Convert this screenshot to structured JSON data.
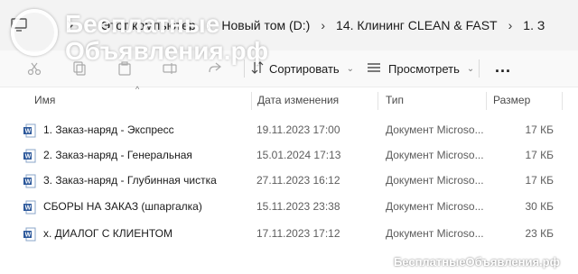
{
  "addressbar": {
    "breadcrumbs": [
      "Этот компьютер",
      "Новый том (D:)",
      "14. Клининг CLEAN & FAST",
      "1. З"
    ]
  },
  "toolbar": {
    "sort_label": "Сортировать",
    "view_label": "Просмотреть",
    "more_label": "..."
  },
  "columns": {
    "name": "Имя",
    "date": "Дата изменения",
    "type": "Тип",
    "size": "Размер"
  },
  "files": [
    {
      "name": "1.  Заказ-наряд - Экспресс",
      "date": "19.11.2023 17:00",
      "type": "Документ Microso...",
      "size": "17 КБ",
      "icon": "word-doc-icon"
    },
    {
      "name": "2.  Заказ-наряд - Генеральная",
      "date": "15.01.2024 17:13",
      "type": "Документ Microso...",
      "size": "17 КБ",
      "icon": "word-doc-icon"
    },
    {
      "name": "3.  Заказ-наряд - Глубинная чистка",
      "date": "27.11.2023 16:12",
      "type": "Документ Microso...",
      "size": "17 КБ",
      "icon": "word-doc-icon"
    },
    {
      "name": "СБОРЫ НА ЗАКАЗ (шпаргалка)",
      "date": "15.11.2023 23:38",
      "type": "Документ Microso...",
      "size": "30 КБ",
      "icon": "word-doc-icon"
    },
    {
      "name": "x. ДИАЛОГ С КЛИЕНТОМ",
      "date": "17.11.2023 17:12",
      "type": "Документ Microso...",
      "size": "23 КБ",
      "icon": "word-doc-icon"
    }
  ],
  "watermark": {
    "line1": "Бесплатные",
    "line2": "Объявления.рф",
    "footer": "БесплатныеОбъявления.рф"
  },
  "colors": {
    "word_blue": "#2b579a",
    "background": "#ffffff",
    "addressbar_bg": "#f3f3f3"
  }
}
